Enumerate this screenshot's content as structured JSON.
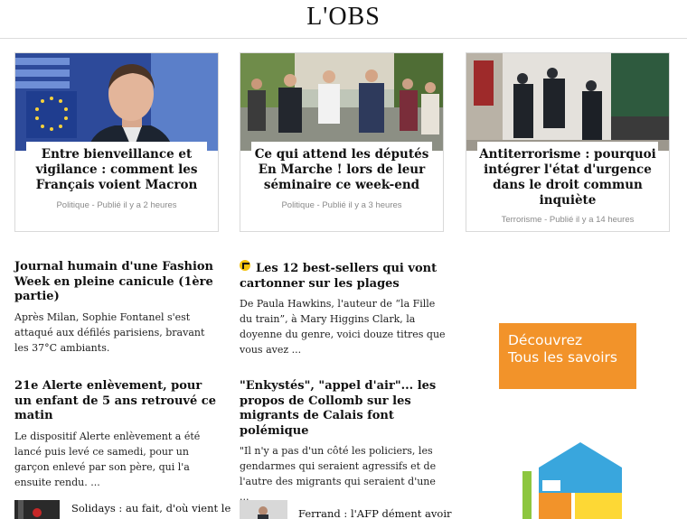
{
  "header": {
    "logo": "L'OBS"
  },
  "top_cards": [
    {
      "title": "Entre bienveillance et vigilance : comment les Français voient Macron",
      "meta": "Politique - Publié il y a 2 heures"
    },
    {
      "title": "Ce qui attend les députés En Marche ! lors de leur séminaire ce week-end",
      "meta": "Politique - Publié il y a 3 heures"
    },
    {
      "title": "Antiterrorisme : pourquoi intégrer l'état d'urgence dans le droit commun inquiète",
      "meta": "Terrorisme - Publié il y a 14 heures"
    }
  ],
  "articles": [
    {
      "title": "Journal humain d'une Fashion Week en pleine canicule (1ère partie)",
      "summary": "Après Milan, Sophie Fontanel s'est attaqué aux défilés parisiens, bravant les 37°C ambiants."
    },
    {
      "title": "Les 12 best-sellers qui vont cartonner sur les plages",
      "summary": "De Paula Hawkins, l'auteur de “la Fille du train”, à Mary Higgins Clark, la doyenne du genre, voici douze titres que vous avez ..."
    },
    {
      "title": "21e Alerte enlèvement, pour un enfant de 5 ans retrouvé ce matin",
      "summary": "Le dispositif Alerte enlèvement a été lancé puis levé ce samedi, pour un garçon enlevé par son père, qui l'a ensuite rendu. ..."
    },
    {
      "title": "\"Enkystés\", \"appel d'air\"... les propos de Collomb sur les migrants de Calais font polémique",
      "summary": "\"Il n'y a pas d'un côté les policiers, les gendarmes qui seraient agressifs et de l'autre des migrants qui seraient d'une ..."
    }
  ],
  "ad": {
    "line1": "Découvrez",
    "line2": "Tous les savoirs"
  },
  "bottom": [
    {
      "title": "Solidays : au fait, d'où vient le"
    },
    {
      "title": "Ferrand : l'AFP dément avoir"
    }
  ]
}
